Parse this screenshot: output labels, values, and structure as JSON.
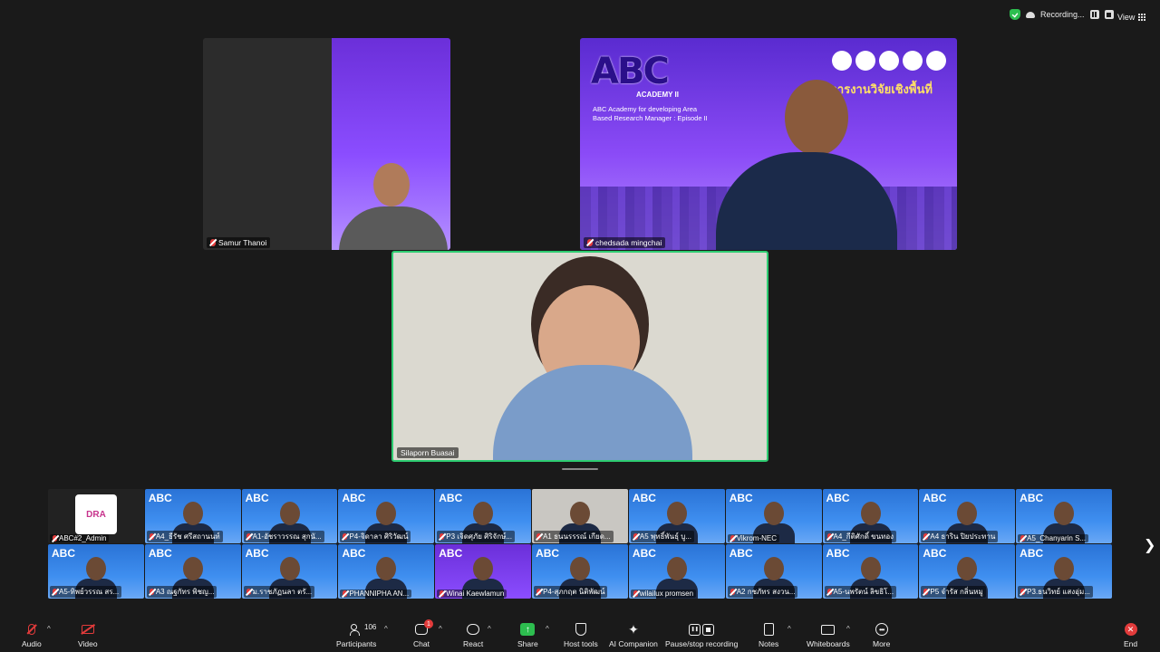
{
  "topbar": {
    "recording_label": "Recording...",
    "view_label": "View"
  },
  "tiles": {
    "samur": {
      "name": "Samur Thanoi"
    },
    "chedsada": {
      "name": "chedsada mingchai",
      "logo_text": "ABC",
      "logo_sub": "ACADEMY II",
      "description": "ABC Academy for developing Area Based Research Manager : Episode II",
      "thai_title": "จัดการงานวิจัยเชิงพื้นที่"
    },
    "silaporn": {
      "name": "Silaporn Buasai"
    }
  },
  "gallery": {
    "row1": [
      "ABC#2_Admin",
      "A4_ธีรัช ศรีสถานนท์",
      "A1-อัชราวรรณ สุกนั...",
      "P4-จิดาลา ศิริวัฒน์",
      "P3 เจิดศุภัย ศิริจักษ์...",
      "A1 ธนนรรรณ์ เกียด...",
      "A5 พุทธิ์พันธุ์ บู...",
      "Vikrom-NEC",
      "A4_กีติศักดิ์ ขนทอง",
      "A4 ธาริน ปิยประทาน",
      "A5_Chanyarin S..."
    ],
    "row2": [
      "A5-ทิพย์วรรณ สร...",
      "A3 ณฐกัทร พิชญ...",
      "ม.ราชภัฏนลา ตรั...",
      "PHANNIPHA AN...",
      "Winai Kaewlamun",
      "P4-สุภกฤต นิติพัฒน์",
      "wilailux promsen",
      "A2 กชภัทร สงวน...",
      "A5-นพรัตน์ ลิขธิโ...",
      "P5 จำรัส กลิ่นหมู",
      "P3.ธนวิทย์ แสงอุ่ม..."
    ],
    "admin_logo": "DRA"
  },
  "toolbar": {
    "audio": "Audio",
    "video": "Video",
    "participants": "Participants",
    "participants_count": "106",
    "chat": "Chat",
    "chat_badge": "1",
    "react": "React",
    "share": "Share",
    "host_tools": "Host tools",
    "ai_companion": "AI Companion",
    "pause_recording": "Pause/stop recording",
    "notes": "Notes",
    "whiteboards": "Whiteboards",
    "more": "More",
    "end": "End"
  },
  "colors": {
    "background": "#1a1a1a",
    "active_speaker_border": "#2ecc71",
    "muted_red": "#e23b3b",
    "share_green": "#2dbd4f"
  }
}
